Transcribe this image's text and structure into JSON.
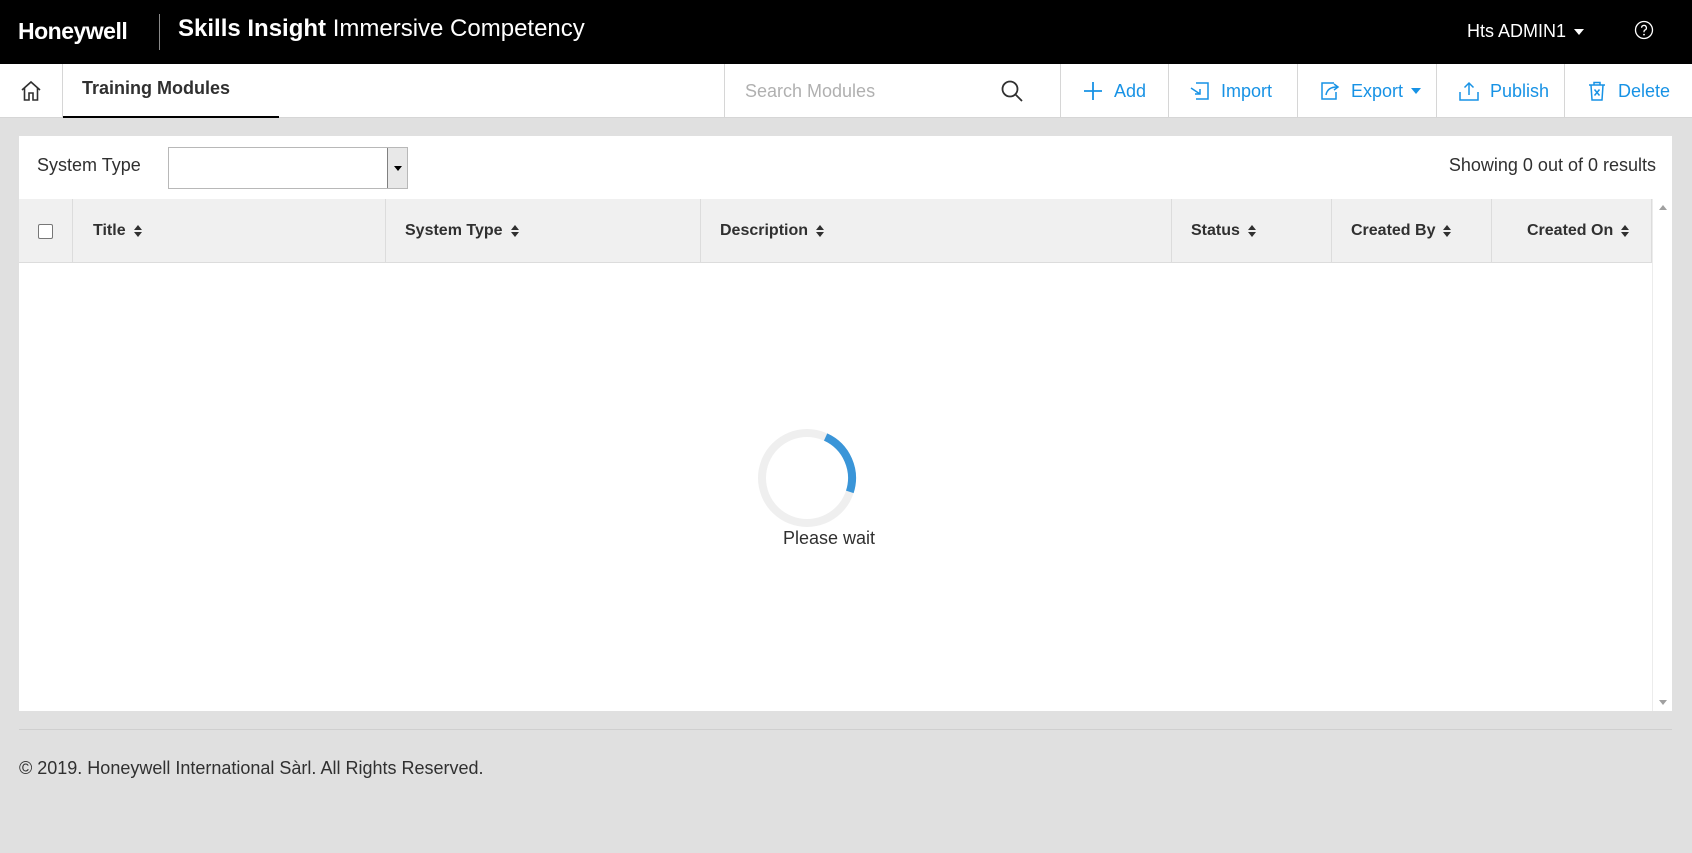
{
  "header": {
    "logo": "Honeywell",
    "app_name_bold": "Skills Insight",
    "app_name_light": "Immersive Competency",
    "user": "Hts ADMIN1",
    "help_icon": "question-circle-icon"
  },
  "toolbar": {
    "page_title": "Training Modules",
    "search_placeholder": "Search Modules",
    "add_label": "Add",
    "import_label": "Import",
    "export_label": "Export",
    "publish_label": "Publish",
    "delete_label": "Delete",
    "accent_color": "#1792e5"
  },
  "filter": {
    "label": "System Type",
    "selected_value": ""
  },
  "results": "Showing 0 out of 0 results",
  "table": {
    "columns": [
      "Title",
      "System Type",
      "Description",
      "Status",
      "Created By",
      "Created On"
    ],
    "rows": []
  },
  "loading": {
    "text": "Please wait",
    "spinner_color": "#3a95d8"
  },
  "footer": {
    "copyright": "© 2019. Honeywell International Sàrl. All Rights Reserved."
  }
}
